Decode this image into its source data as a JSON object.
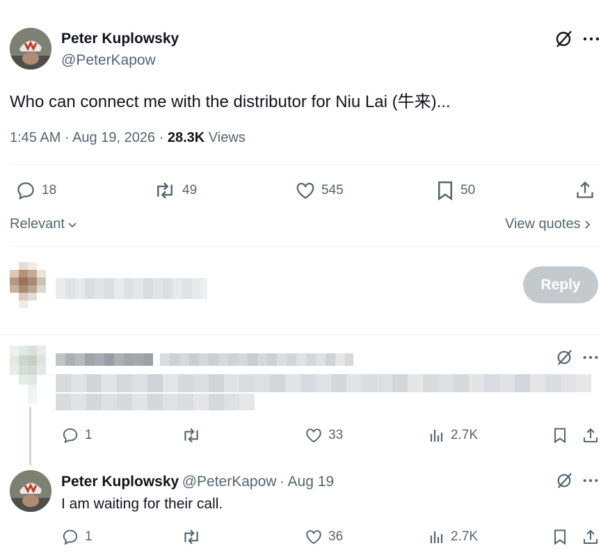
{
  "tweet": {
    "author_name": "Peter Kuplowsky",
    "author_handle": "@PeterKapow",
    "text": "Who can connect me with the distributor for Niu Lai (牛来)...",
    "time": "1:45 AM",
    "date": "Aug 19, 2026",
    "views_count": "28.3K",
    "views_label": "Views",
    "replies": "18",
    "reposts": "49",
    "likes": "545",
    "bookmarks": "50"
  },
  "sort": {
    "label": "Relevant",
    "view_quotes": "View quotes"
  },
  "composer": {
    "reply_button": "Reply"
  },
  "replies": [
    {
      "name": "",
      "handle": "",
      "text": "",
      "replies": "1",
      "reposts": "",
      "likes": "33",
      "views": "2.7K"
    },
    {
      "name": "Peter Kuplowsky",
      "handle": "@PeterKapow",
      "date": "· Aug 19",
      "text": "I am waiting for their call.",
      "replies": "1",
      "reposts": "",
      "likes": "36",
      "views": "2.7K"
    }
  ],
  "icons": {
    "grok": "grok-icon",
    "more": "more-icon",
    "reply": "reply-icon",
    "repost": "repost-icon",
    "like": "like-icon",
    "bookmark": "bookmark-icon",
    "share": "share-icon",
    "views": "views-icon"
  },
  "colors": {
    "text": "#0f1419",
    "secondary": "#536471",
    "divider": "#eff3f4",
    "reply_button_disabled": "#c3c9cd"
  }
}
